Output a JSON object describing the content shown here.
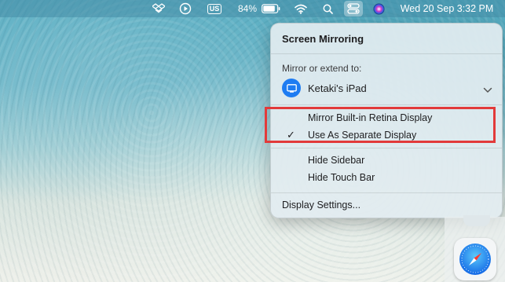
{
  "menubar": {
    "battery_percent": "84%",
    "keyboard_layout": "US",
    "datetime": "Wed 20 Sep  3:32 PM",
    "icons": [
      "dropbox-icon",
      "play-icon",
      "keyboard-layout-icon",
      "battery-icon",
      "wifi-icon",
      "search-icon",
      "control-center-icon",
      "siri-icon"
    ]
  },
  "panel": {
    "title": "Screen Mirroring",
    "section_label": "Mirror or extend to:",
    "device_name": "Ketaki's iPad",
    "options": [
      {
        "label": "Mirror Built-in Retina Display",
        "checked": false
      },
      {
        "label": "Use As Separate Display",
        "checked": true
      }
    ],
    "extra_options": [
      "Hide Sidebar",
      "Hide Touch Bar"
    ],
    "footer_label": "Display Settings...",
    "check_glyph": "✓"
  },
  "colors": {
    "accent": "#1e7cf2",
    "highlight_border": "#e23a3a"
  }
}
